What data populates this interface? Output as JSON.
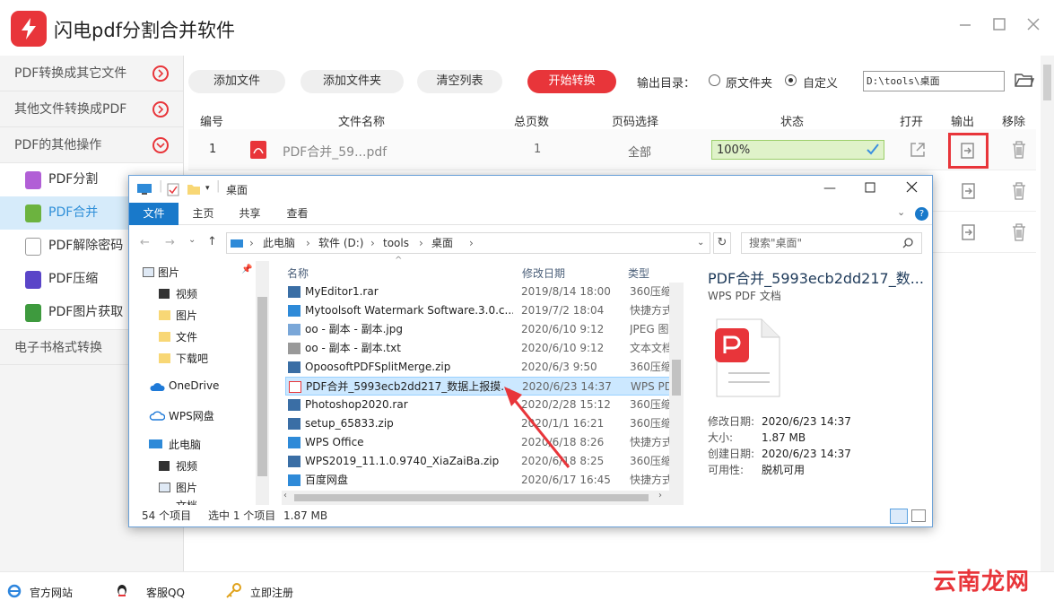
{
  "app": {
    "title": "闪电pdf分割合并软件"
  },
  "sidebar": {
    "groups": [
      {
        "label": "PDF转换成其它文件"
      },
      {
        "label": "其他文件转换成PDF"
      },
      {
        "label": "PDF的其他操作"
      }
    ],
    "items": [
      {
        "label": "PDF分割",
        "color": "#b15fd6"
      },
      {
        "label": "PDF合并",
        "color": "#6cb33f"
      },
      {
        "label": "PDF解除密码",
        "color": "#9a9a9a"
      },
      {
        "label": "PDF压缩",
        "color": "#5a45c8"
      },
      {
        "label": "PDF图片获取",
        "color": "#3e9a3e"
      }
    ],
    "bottom_group": "电子书格式转换"
  },
  "toolbar": {
    "add_file": "添加文件",
    "add_folder": "添加文件夹",
    "clear_list": "清空列表",
    "start": "开始转换",
    "output_label": "输出目录：",
    "opt_original": "原文件夹",
    "opt_custom": "自定义",
    "output_path": "D:\\tools\\桌面"
  },
  "table": {
    "headers": [
      "编号",
      "文件名称",
      "总页数",
      "页码选择",
      "状态",
      "打开",
      "输出",
      "移除"
    ],
    "row": {
      "index": "1",
      "name": "PDF合并_59...pdf",
      "pages": "1",
      "range": "全部",
      "progress_text": "100%",
      "progress": 1.0
    }
  },
  "explorer": {
    "title": "桌面",
    "tabs": [
      "文件",
      "主页",
      "共享",
      "查看"
    ],
    "breadcrumb": [
      "此电脑",
      "软件 (D:)",
      "tools",
      "桌面"
    ],
    "search_placeholder": "搜索\"桌面\"",
    "nav": [
      {
        "label": "图片"
      },
      {
        "label": "视频"
      },
      {
        "label": "图片"
      },
      {
        "label": "文件"
      },
      {
        "label": "下载吧"
      },
      {
        "label": "OneDrive"
      },
      {
        "label": "WPS网盘"
      },
      {
        "label": "此电脑"
      },
      {
        "label": "视频"
      },
      {
        "label": "图片"
      },
      {
        "label": "文档"
      }
    ],
    "columns": {
      "name": "名称",
      "date": "修改日期",
      "type": "类型"
    },
    "files": [
      {
        "name": "MyEditor1.rar",
        "date": "2019/8/14 18:00",
        "type": "360压缩"
      },
      {
        "name": "Mytoolsoft Watermark Software.3.0.c...",
        "date": "2019/7/2 18:04",
        "type": "快捷方式"
      },
      {
        "name": "oo - 副本 - 副本.jpg",
        "date": "2020/6/10 9:12",
        "type": "JPEG 图"
      },
      {
        "name": "oo - 副本 - 副本.txt",
        "date": "2020/6/10 9:12",
        "type": "文本文档"
      },
      {
        "name": "OpoosoftPDFSplitMerge.zip",
        "date": "2020/6/3 9:50",
        "type": "360压缩"
      },
      {
        "name": "PDF合并_5993ecb2dd217_数据上报摸...",
        "date": "2020/6/23 14:37",
        "type": "WPS PD"
      },
      {
        "name": "Photoshop2020.rar",
        "date": "2020/2/28 15:12",
        "type": "360压缩"
      },
      {
        "name": "setup_65833.zip",
        "date": "2020/1/1 16:21",
        "type": "360压缩"
      },
      {
        "name": "WPS Office",
        "date": "2020/6/18 8:26",
        "type": "快捷方式"
      },
      {
        "name": "WPS2019_11.1.0.9740_XiaZaiBa.zip",
        "date": "2020/6/18 8:25",
        "type": "360压缩"
      },
      {
        "name": "百度网盘",
        "date": "2020/6/17 16:45",
        "type": "快捷方式"
      }
    ],
    "preview": {
      "title": "PDF合并_5993ecb2dd217_数...",
      "subtitle": "WPS PDF 文档",
      "modified_label": "修改日期:",
      "modified": "2020/6/23 14:37",
      "size_label": "大小:",
      "size": "1.87 MB",
      "created_label": "创建日期:",
      "created": "2020/6/23 14:37",
      "avail_label": "可用性:",
      "avail": "脱机可用"
    },
    "status": {
      "count": "54 个项目",
      "selected": "选中 1 个项目",
      "size": "1.87 MB"
    }
  },
  "footer": {
    "website": "官方网站",
    "support": "客服QQ",
    "register": "立即注册",
    "watermark": "云南龙网"
  },
  "colors": {
    "accent": "#e8353a",
    "active": "#2f8fd8",
    "progress": "#dff2c9"
  }
}
